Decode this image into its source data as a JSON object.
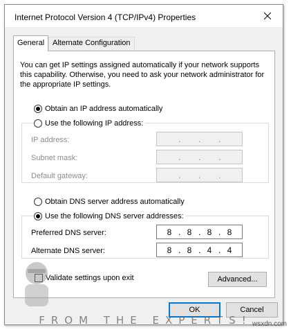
{
  "window": {
    "title": "Internet Protocol Version 4 (TCP/IPv4) Properties",
    "close_icon": "close-icon"
  },
  "tabs": [
    {
      "label": "General",
      "active": true
    },
    {
      "label": "Alternate Configuration",
      "active": false
    }
  ],
  "description": "You can get IP settings assigned automatically if your network supports this capability. Otherwise, you need to ask your network administrator for the appropriate IP settings.",
  "ip_section": {
    "auto_label": "Obtain an IP address automatically",
    "auto_selected": true,
    "manual_label": "Use the following IP address:",
    "manual_selected": false,
    "fields": [
      {
        "label": "IP address:",
        "value": [
          "",
          "",
          "",
          ""
        ],
        "enabled": false
      },
      {
        "label": "Subnet mask:",
        "value": [
          "",
          "",
          "",
          ""
        ],
        "enabled": false
      },
      {
        "label": "Default gateway:",
        "value": [
          "",
          "",
          "",
          ""
        ],
        "enabled": false
      }
    ]
  },
  "dns_section": {
    "auto_label": "Obtain DNS server address automatically",
    "auto_selected": false,
    "manual_label": "Use the following DNS server addresses:",
    "manual_selected": true,
    "preferred_label": "Preferred DNS server:",
    "preferred_value": [
      "8",
      "8",
      "8",
      "8"
    ],
    "alternate_label": "Alternate DNS server:",
    "alternate_value": [
      "8",
      "8",
      "4",
      "4"
    ]
  },
  "validate": {
    "label": "Validate settings upon exit",
    "checked": false
  },
  "buttons": {
    "advanced": "Advanced...",
    "ok": "OK",
    "cancel": "Cancel"
  },
  "watermark": {
    "text": "FROM THE EXPERTS!",
    "site": "wsxdn.com"
  }
}
